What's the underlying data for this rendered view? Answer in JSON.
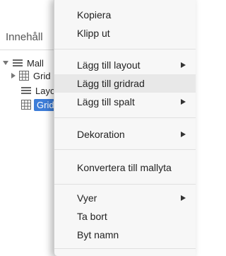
{
  "panel": {
    "title": "Innehåll",
    "tree": [
      {
        "label": "Mall",
        "icon": "list-icon",
        "expanded": true
      },
      {
        "label": "Grid",
        "icon": "grid-icon",
        "expanded": false
      },
      {
        "label": "Layo",
        "icon": "list-icon"
      },
      {
        "label": "Grid",
        "icon": "grid-icon",
        "selected": true
      }
    ]
  },
  "menu": {
    "items": [
      {
        "label": "Kopiera"
      },
      {
        "label": "Klipp ut"
      },
      {
        "label": "Lägg till layout",
        "submenu": true
      },
      {
        "label": "Lägg till gridrad",
        "highlighted": true
      },
      {
        "label": "Lägg till spalt",
        "submenu": true
      },
      {
        "label": "Dekoration",
        "submenu": true
      },
      {
        "label": "Konvertera till mallyta"
      },
      {
        "label": "Vyer",
        "submenu": true
      },
      {
        "label": "Ta bort"
      },
      {
        "label": "Byt namn"
      }
    ]
  },
  "colors": {
    "selection": "#3d7dd8",
    "menu_background": "#f7f7f7",
    "menu_highlight": "#e8e8e8"
  }
}
